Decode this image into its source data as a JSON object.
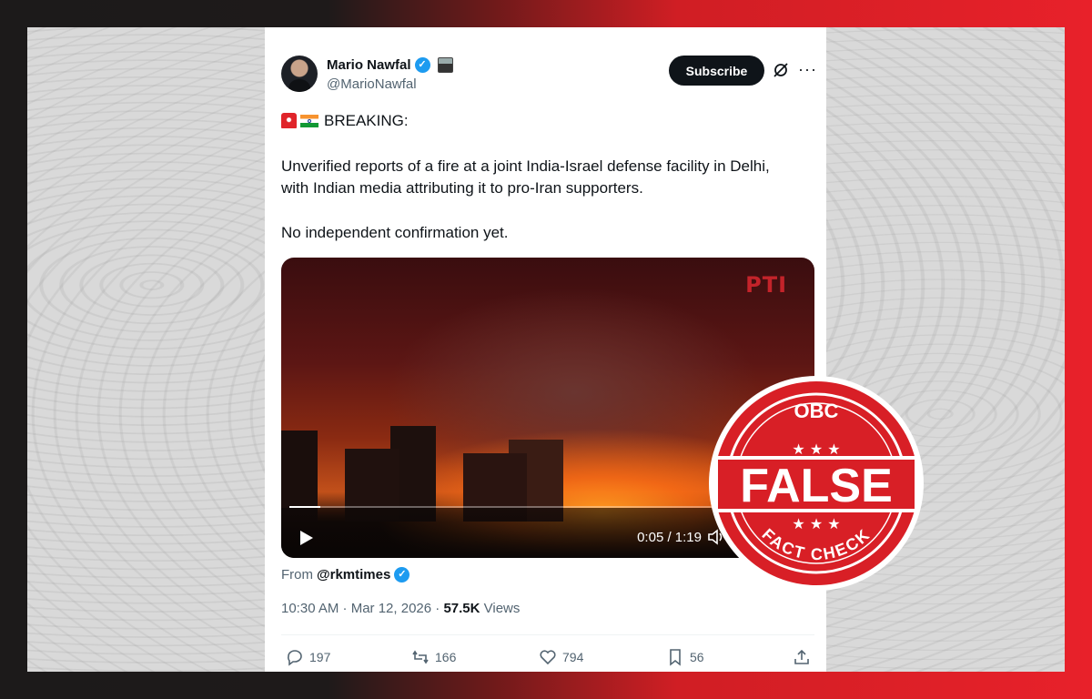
{
  "tweet": {
    "author_name": "Mario Nawfal",
    "author_handle": "@MarioNawfal",
    "subscribe_label": "Subscribe",
    "more_label": "···",
    "line1_text": "BREAKING:",
    "line2_text": "Unverified reports of a fire at a joint India-Israel defense facility in Delhi,",
    "line3_text": "with Indian media attributing it to pro-Iran supporters.",
    "line4_text": "No independent confirmation yet.",
    "video": {
      "watermark": "PTI",
      "time": "0:05 / 1:19",
      "progress_fraction": 0.06
    },
    "from_prefix": "From",
    "from_handle": "@rkmtimes",
    "time_date": "10:30 AM · Mar 12, 2026 ·",
    "views_count": "57.5K",
    "views_label": "Views",
    "actions": {
      "replies": "197",
      "reposts": "166",
      "likes": "794",
      "bookmarks": "56"
    }
  },
  "stamp": {
    "top_text": "OBC",
    "main_text": "FALSE",
    "bottom_text": "FACT CHECK",
    "color": "#d81f26"
  },
  "colors": {
    "accent_blue": "#1d9bf0",
    "text_primary": "#0f1419",
    "text_secondary": "#536471",
    "stamp_red": "#d81f26"
  }
}
